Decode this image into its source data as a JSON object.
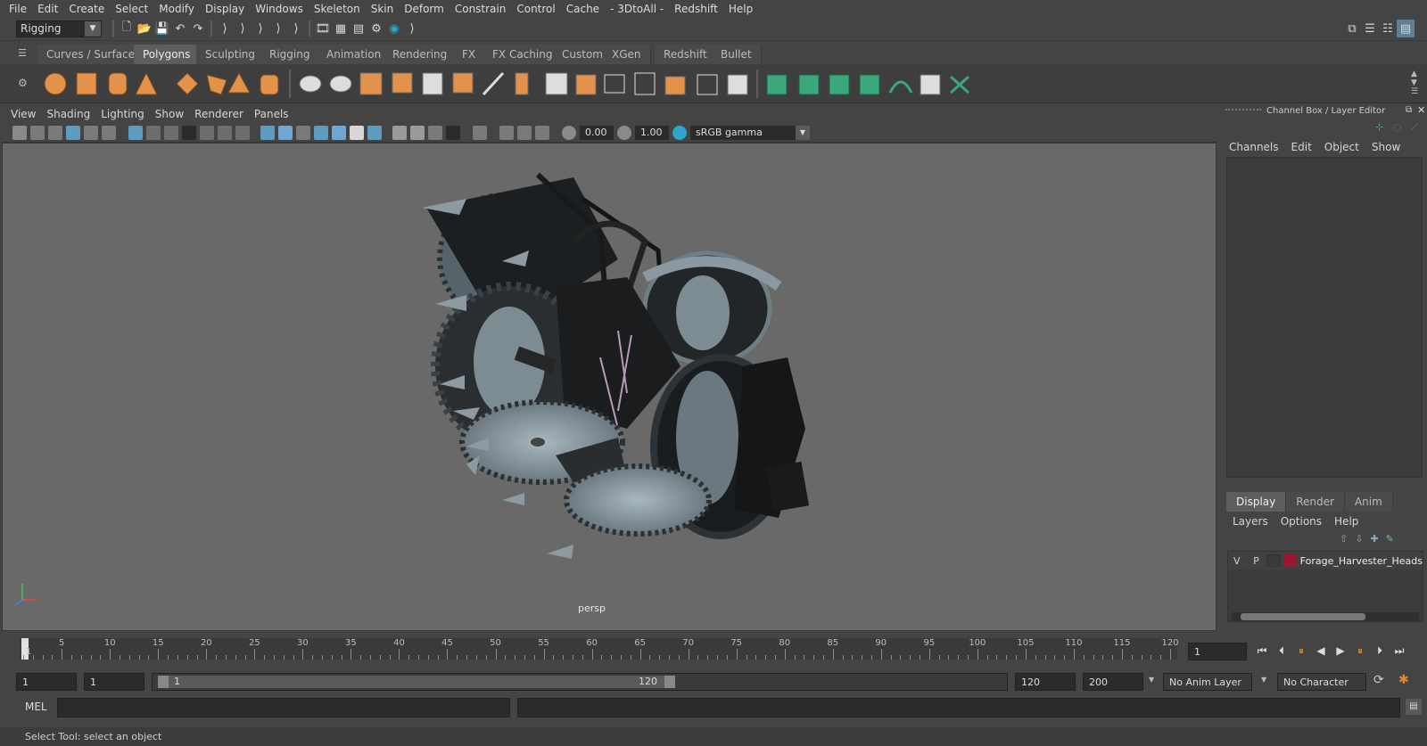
{
  "menubar": [
    "File",
    "Edit",
    "Create",
    "Select",
    "Modify",
    "Display",
    "Windows",
    "Skeleton",
    "Skin",
    "Deform",
    "Constrain",
    "Control",
    "Cache",
    "- 3DtoAll -",
    "Redshift",
    "Help"
  ],
  "status_line": {
    "mode": "Rigging"
  },
  "shelf_tabs": [
    "Curves / Surfaces",
    "Polygons",
    "Sculpting",
    "Rigging",
    "Animation",
    "Rendering",
    "FX",
    "FX Caching",
    "Custom",
    "XGen",
    "Redshift",
    "Bullet"
  ],
  "shelf_active_tab": "Polygons",
  "viewport": {
    "menu": [
      "View",
      "Shading",
      "Lighting",
      "Show",
      "Renderer",
      "Panels"
    ],
    "exposure": "0.00",
    "gamma": "1.00",
    "color_space": "sRGB gamma",
    "camera_label": "persp",
    "axis": {
      "x": "x",
      "y": "y",
      "z": "z"
    }
  },
  "channel_box": {
    "title": "Channel Box / Layer Editor",
    "menu": [
      "Channels",
      "Edit",
      "Object",
      "Show"
    ]
  },
  "layer_editor": {
    "tabs": [
      "Display",
      "Render",
      "Anim"
    ],
    "active_tab": "Display",
    "menu": [
      "Layers",
      "Options",
      "Help"
    ],
    "layer": {
      "visible": "V",
      "playback": "P",
      "name": "Forage_Harvester_Heads",
      "color": "#9b1531"
    }
  },
  "timeline": {
    "ticks": [
      "1",
      "5",
      "10",
      "15",
      "20",
      "25",
      "30",
      "35",
      "40",
      "45",
      "50",
      "55",
      "60",
      "65",
      "70",
      "75",
      "80",
      "85",
      "90",
      "95",
      "100",
      "105",
      "110",
      "115",
      "120"
    ],
    "current_frame": "1"
  },
  "range": {
    "start": "1",
    "playback_start": "1",
    "slider_start": "1",
    "slider_end": "120",
    "playback_end": "120",
    "end": "200",
    "anim_layer": "No Anim Layer",
    "character_set": "No Character Set"
  },
  "command_line": {
    "label": "MEL"
  },
  "help_line": "Select Tool: select an object"
}
